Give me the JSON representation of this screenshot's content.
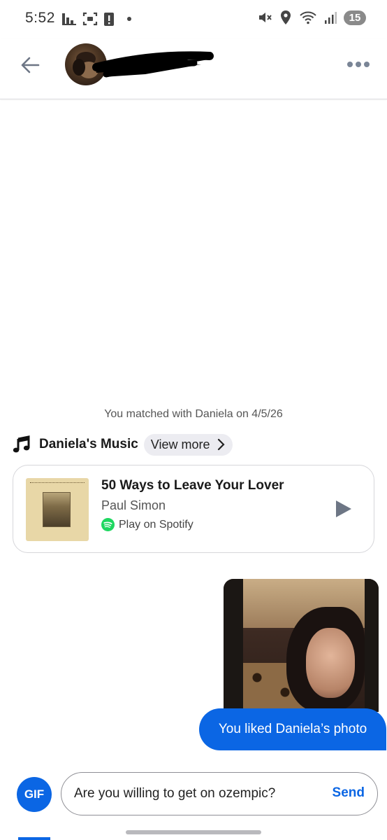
{
  "status_bar": {
    "time": "5:52",
    "battery": "15",
    "icons": [
      "bar-chart-icon",
      "screenshot-icon",
      "alert-icon",
      "mute-icon",
      "location-icon",
      "wifi-icon",
      "signal-icon"
    ]
  },
  "header": {
    "back_icon": "arrow-left-icon",
    "more_icon": "more-horizontal-icon"
  },
  "match_text": "You matched with Daniela on 4/5/26",
  "music": {
    "title": "Daniela's Music",
    "view_more": "View more",
    "song": {
      "title": "50 Ways to Leave Your Lover",
      "artist": "Paul Simon",
      "spotify_label": "Play on Spotify"
    }
  },
  "messages": {
    "liked_photo_text": "You liked Daniela’s photo"
  },
  "composer": {
    "gif_label": "GIF",
    "input_value": "Are you willing to get on ozempic?",
    "send_label": "Send"
  },
  "colors": {
    "accent": "#0b66e4",
    "spotify": "#1ed760",
    "icon_gray": "#7a8596"
  }
}
